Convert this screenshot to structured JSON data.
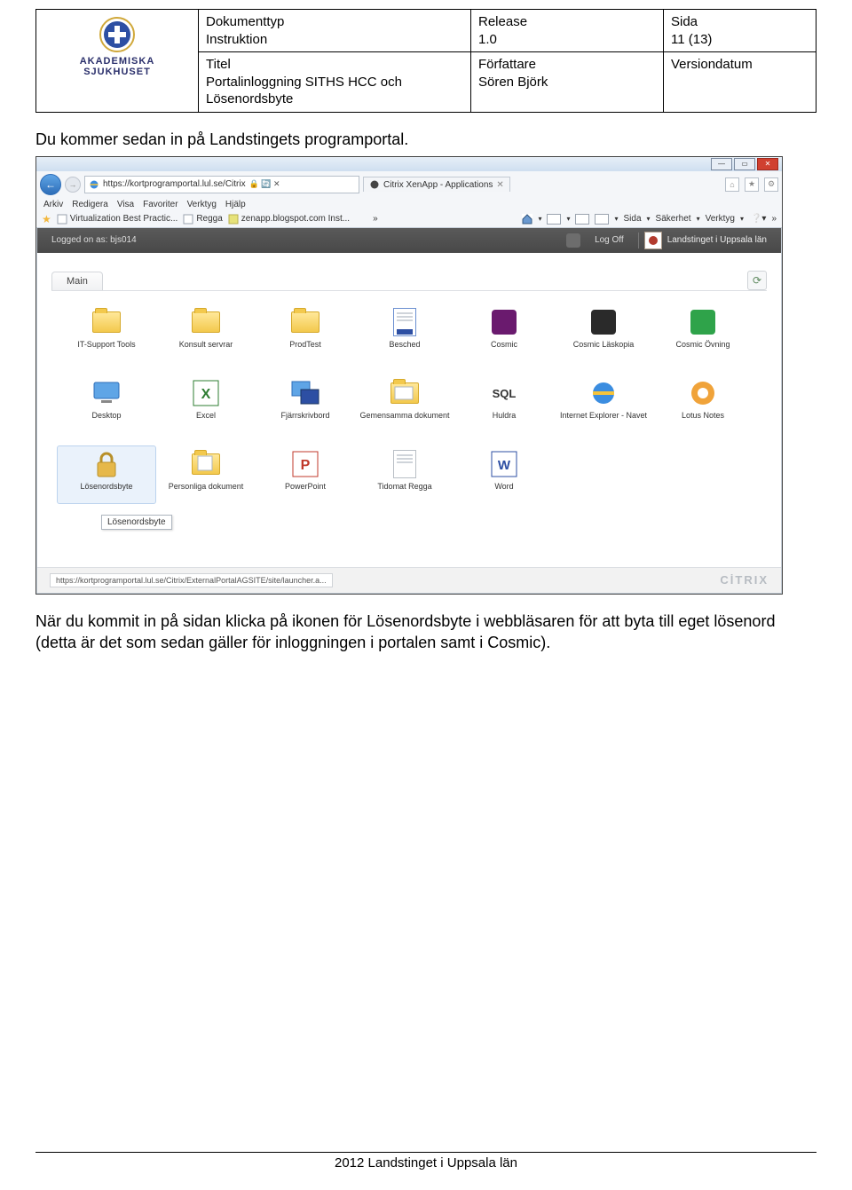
{
  "doc": {
    "org_line1": "AKADEMISKA",
    "org_line2": "SJUKHUSET",
    "dokumenttyp_label": "Dokumenttyp",
    "dokumenttyp_value": "Instruktion",
    "release_label": "Release",
    "release_value": "1.0",
    "sida_label": "Sida",
    "sida_value": "11 (13)",
    "titel_label": "Titel",
    "titel_value": "Portalinloggning SITHS HCC och Lösenordsbyte",
    "forfattare_label": "Författare",
    "forfattare_value": "Sören Björk",
    "versiondatum_label": "Versiondatum"
  },
  "intro_text": "Du kommer sedan in på Landstingets programportal.",
  "browser": {
    "url": "https://kortprogramportal.lul.se/Citrix",
    "url_suffix_icons": "🔒 🔄 ✕",
    "tab_title": "Citrix XenApp - Applications",
    "menubar": [
      "Arkiv",
      "Redigera",
      "Visa",
      "Favoriter",
      "Verktyg",
      "Hjälp"
    ],
    "fav_items": [
      "Virtualization Best Practic...",
      "Regga",
      "zenapp.blogspot.com Inst..."
    ],
    "toolmenu": [
      "Sida",
      "Säkerhet",
      "Verktyg"
    ],
    "search_placeholder": "ρ ▾"
  },
  "portal": {
    "logged_label": "Logged on as:",
    "logged_user": "bjs014",
    "logoff": "Log Off",
    "brand_text": "Landstinget i Uppsala län",
    "main_tab": "Main",
    "tooltip": "Lösenordsbyte",
    "status_url": "https://kortprogramportal.lul.se/Citrix/ExternalPortalAGSITE/site/launcher.a...",
    "citrix": "CİTRIX",
    "apps_row1": [
      {
        "name": "IT-Support Tools",
        "icon": "folder"
      },
      {
        "name": "Konsult servrar",
        "icon": "folder"
      },
      {
        "name": "ProdTest",
        "icon": "folder"
      },
      {
        "name": "Besched",
        "icon": "besched"
      },
      {
        "name": "Cosmic",
        "icon": "cosmic-purple"
      },
      {
        "name": "Cosmic Läskopia",
        "icon": "cosmic-dark"
      },
      {
        "name": "Cosmic Övning",
        "icon": "cosmic-green"
      }
    ],
    "apps_row2": [
      {
        "name": "Desktop",
        "icon": "desktop"
      },
      {
        "name": "Excel",
        "icon": "excel"
      },
      {
        "name": "Fjärrskrivbord",
        "icon": "rdp"
      },
      {
        "name": "Gemensamma dokument",
        "icon": "docs"
      },
      {
        "name": "Huldra",
        "icon": "sql"
      },
      {
        "name": "Internet Explorer - Navet",
        "icon": "ie"
      },
      {
        "name": "Lotus Notes",
        "icon": "lotus"
      }
    ],
    "apps_row3": [
      {
        "name": "Lösenordsbyte",
        "icon": "lock",
        "selected": true
      },
      {
        "name": "Personliga dokument",
        "icon": "personal"
      },
      {
        "name": "PowerPoint",
        "icon": "ppt"
      },
      {
        "name": "Tidomat Regga",
        "icon": "tidomat"
      },
      {
        "name": "Word",
        "icon": "word"
      }
    ]
  },
  "outro_text": "När du kommit in på sidan klicka på ikonen för Lösenordsbyte i webbläsaren för att byta till eget lösenord (detta är det som sedan gäller för inloggningen i portalen samt i Cosmic).",
  "footer": "2012 Landstinget i Uppsala län"
}
